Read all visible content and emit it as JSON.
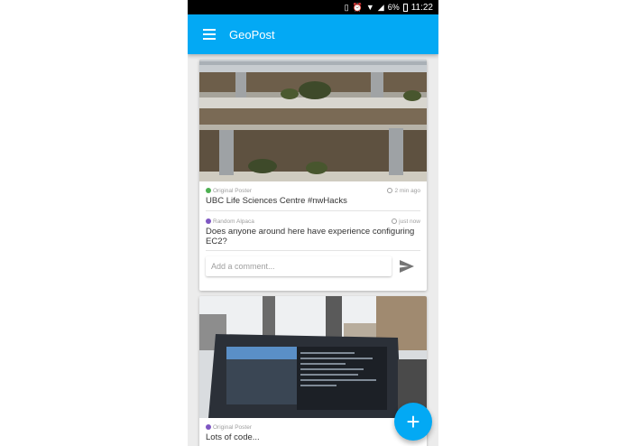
{
  "status_bar": {
    "icons": [
      "vibrate-icon",
      "alarm-icon",
      "wifi-icon",
      "signal-icon"
    ],
    "battery": "6%",
    "time": "11:22"
  },
  "app_bar": {
    "title": "GeoPost",
    "menu_icon": "hamburger-menu-icon"
  },
  "posts": [
    {
      "image": "atrium-balconies-photo",
      "entries": [
        {
          "author": "Original Poster",
          "author_color": "#4caf50",
          "time": "2 min ago",
          "text": "UBC Life Sciences Centre #nwHacks"
        },
        {
          "author": "Random Alpaca",
          "author_color": "#7e57c2",
          "time": "just now",
          "text": "Does anyone around here have experience configuring EC2?"
        }
      ],
      "comment_placeholder": "Add a comment...",
      "send_icon": "send-icon"
    },
    {
      "image": "laptop-on-desk-photo",
      "entries": [
        {
          "author": "Original Poster",
          "author_color": "#7e57c2",
          "time": "",
          "text": "Lots of code..."
        }
      ]
    }
  ],
  "fab": {
    "label": "+",
    "icon": "add-icon"
  },
  "colors": {
    "primary": "#03a9f4",
    "statusbar": "#000000",
    "background": "#ececec"
  }
}
